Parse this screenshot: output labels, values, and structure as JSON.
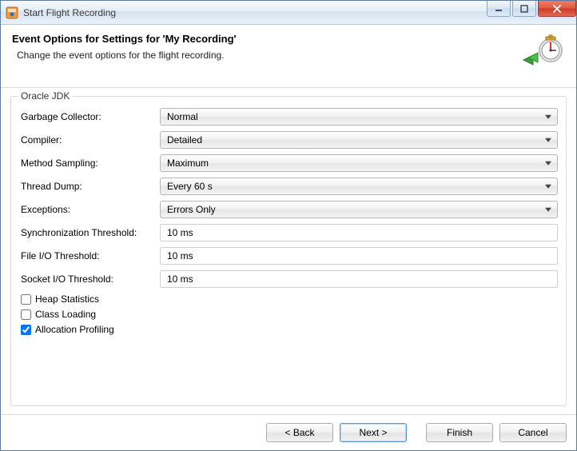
{
  "window": {
    "title": "Start Flight Recording"
  },
  "header": {
    "title": "Event Options for Settings for 'My Recording'",
    "description": "Change the event options for the flight recording."
  },
  "group": {
    "legend": "Oracle JDK",
    "fields": {
      "garbage_collector": {
        "label": "Garbage Collector:",
        "value": "Normal"
      },
      "compiler": {
        "label": "Compiler:",
        "value": "Detailed"
      },
      "method_sampling": {
        "label": "Method Sampling:",
        "value": "Maximum"
      },
      "thread_dump": {
        "label": "Thread Dump:",
        "value": "Every 60 s"
      },
      "exceptions": {
        "label": "Exceptions:",
        "value": "Errors Only"
      },
      "sync_threshold": {
        "label": "Synchronization Threshold:",
        "value": "10 ms"
      },
      "file_io_threshold": {
        "label": "File I/O Threshold:",
        "value": "10 ms"
      },
      "socket_io_threshold": {
        "label": "Socket I/O Threshold:",
        "value": "10 ms"
      }
    },
    "checks": {
      "heap_statistics": {
        "label": "Heap Statistics",
        "checked": false
      },
      "class_loading": {
        "label": "Class Loading",
        "checked": false
      },
      "allocation_profiling": {
        "label": "Allocation Profiling",
        "checked": true
      }
    }
  },
  "buttons": {
    "back": "< Back",
    "next": "Next >",
    "finish": "Finish",
    "cancel": "Cancel"
  }
}
